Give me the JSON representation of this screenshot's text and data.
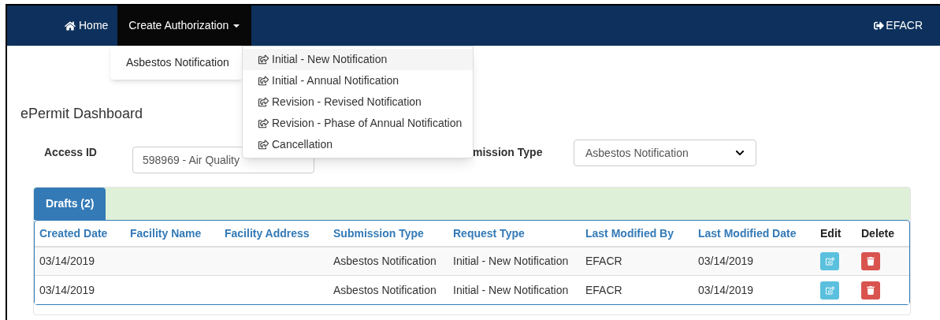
{
  "navbar": {
    "home": "Home",
    "menu": {
      "label": "Create Authorization",
      "expanded": true
    },
    "user": "EFACR"
  },
  "menu_items": [
    {
      "label": "Asbestos Notification",
      "selected": true
    }
  ],
  "submenu_items": [
    {
      "label": "Initial - New Notification",
      "selected": true
    },
    {
      "label": "Initial - Annual Notification",
      "selected": false
    },
    {
      "label": "Revision - Revised Notification",
      "selected": false
    },
    {
      "label": "Revision - Phase of Annual Notification",
      "selected": false
    },
    {
      "label": "Cancellation",
      "selected": false
    }
  ],
  "page_title": "ePermit Dashboard",
  "filters": [
    {
      "kind": "text",
      "label": "Access ID",
      "value": "598969 - Air Quality"
    },
    {
      "kind": "select",
      "label": "mission Type",
      "value": "Asbestos Notification"
    }
  ],
  "tabs": [
    {
      "label": "Drafts (2)",
      "selected": true
    }
  ],
  "table": {
    "columns": [
      {
        "label": "Created Date",
        "kind": "link"
      },
      {
        "label": "Facility Name",
        "kind": "link"
      },
      {
        "label": "Facility Address",
        "kind": "link"
      },
      {
        "label": "Submission Type",
        "kind": "link"
      },
      {
        "label": "Request Type",
        "kind": "link"
      },
      {
        "label": "Last Modified By",
        "kind": "link"
      },
      {
        "label": "Last Modified Date",
        "kind": "link"
      },
      {
        "label": "Edit",
        "kind": "plain"
      },
      {
        "label": "Delete",
        "kind": "plain"
      }
    ],
    "rows": [
      {
        "cells": [
          "03/14/2019",
          "",
          "",
          "Asbestos Notification",
          "Initial - New Notification",
          "EFACR",
          "03/14/2019"
        ]
      },
      {
        "cells": [
          "03/14/2019",
          "",
          "",
          "Asbestos Notification",
          "Initial - New Notification",
          "EFACR",
          "03/14/2019"
        ]
      }
    ]
  }
}
